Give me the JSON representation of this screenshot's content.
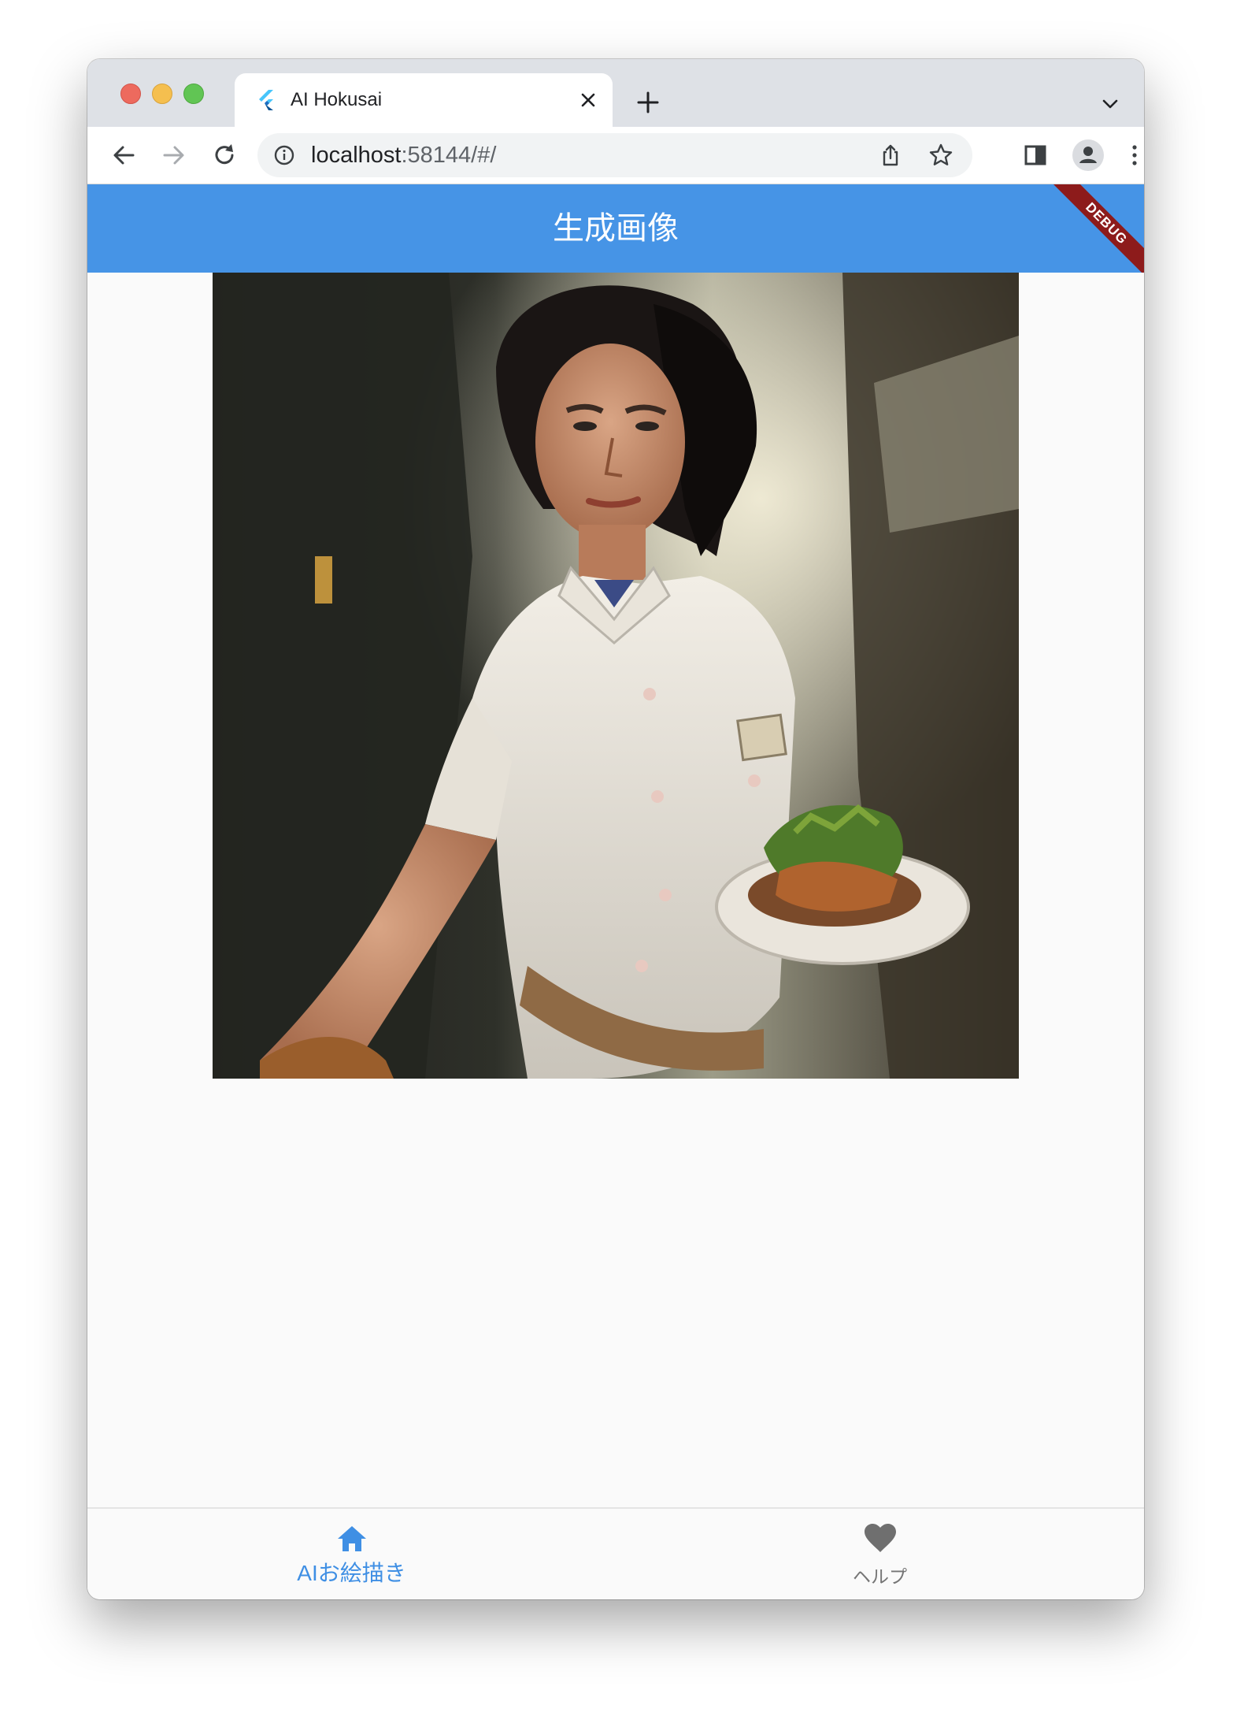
{
  "browser": {
    "tab_title": "AI Hokusai",
    "url_host": "localhost",
    "url_path": ":58144/#/"
  },
  "app": {
    "appbar_title": "生成画像",
    "debug_banner": "DEBUG",
    "accent_color": "#4694e6",
    "bottom_nav": [
      {
        "label": "AIお絵描き",
        "icon": "home-icon",
        "selected": true
      },
      {
        "label": "ヘルプ",
        "icon": "heart-icon",
        "selected": false
      }
    ]
  }
}
